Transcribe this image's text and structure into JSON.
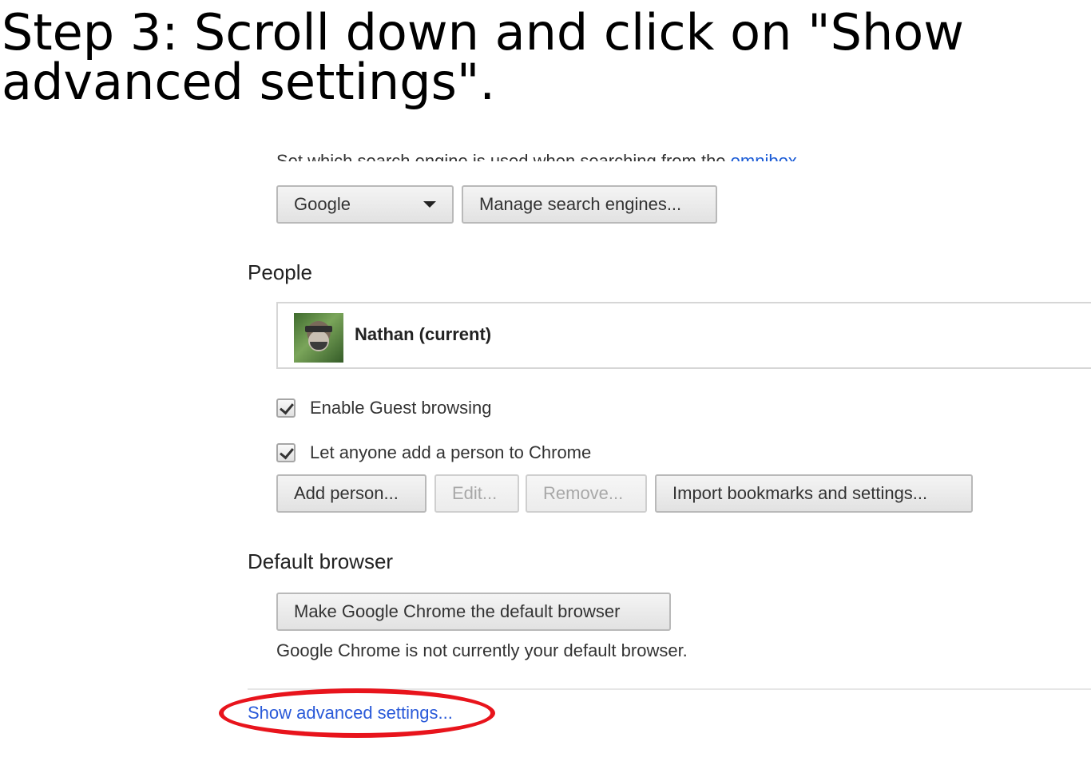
{
  "instruction": {
    "line1": "Step 3: Scroll down and click on \"Show",
    "line2": "advanced settings\"."
  },
  "search": {
    "description_prefix": "Set which search engine is used when searching from the ",
    "description_link": "omnibox",
    "description_suffix": ".",
    "engine_selected": "Google",
    "manage_button": "Manage search engines..."
  },
  "people": {
    "heading": "People",
    "current_profile": "Nathan (current)",
    "guest_browsing_label": "Enable Guest browsing",
    "guest_browsing_checked": true,
    "anyone_add_label": "Let anyone add a person to Chrome",
    "anyone_add_checked": true,
    "buttons": {
      "add": "Add person...",
      "edit": "Edit...",
      "remove": "Remove...",
      "import": "Import bookmarks and settings..."
    }
  },
  "default_browser": {
    "heading": "Default browser",
    "make_default_button": "Make Google Chrome the default browser",
    "status": "Google Chrome is not currently your default browser."
  },
  "advanced_link": "Show advanced settings...",
  "colors": {
    "link": "#2a5ad9",
    "highlight": "#e8141c"
  }
}
